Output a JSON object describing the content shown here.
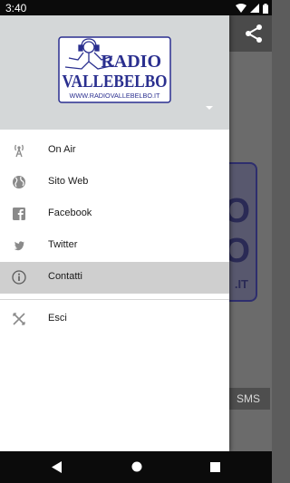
{
  "status_bar": {
    "time": "3:40"
  },
  "logo": {
    "line1": "RADIO",
    "line2": "VALLEBELBO",
    "url": "WWW.RADIOVALLEBELBO.IT",
    "color": "#2a2f8f"
  },
  "background": {
    "logo_line1": "O",
    "logo_line2": "O",
    "logo_url": ".IT",
    "sms_label": "SMS"
  },
  "menu": {
    "items": [
      {
        "label": "On Air",
        "icon": "radio-tower-icon"
      },
      {
        "label": "Sito Web",
        "icon": "globe-icon"
      },
      {
        "label": "Facebook",
        "icon": "facebook-icon"
      },
      {
        "label": "Twitter",
        "icon": "twitter-icon"
      },
      {
        "label": "Contatti",
        "icon": "info-icon",
        "selected": true
      }
    ],
    "exit": {
      "label": "Esci",
      "icon": "close-icon"
    }
  },
  "colors": {
    "header_bg": "#d4d7d8",
    "selected_bg": "#cfcfcf",
    "icon_gray": "#8a8a8a",
    "scrim": "#5c5c5c"
  }
}
